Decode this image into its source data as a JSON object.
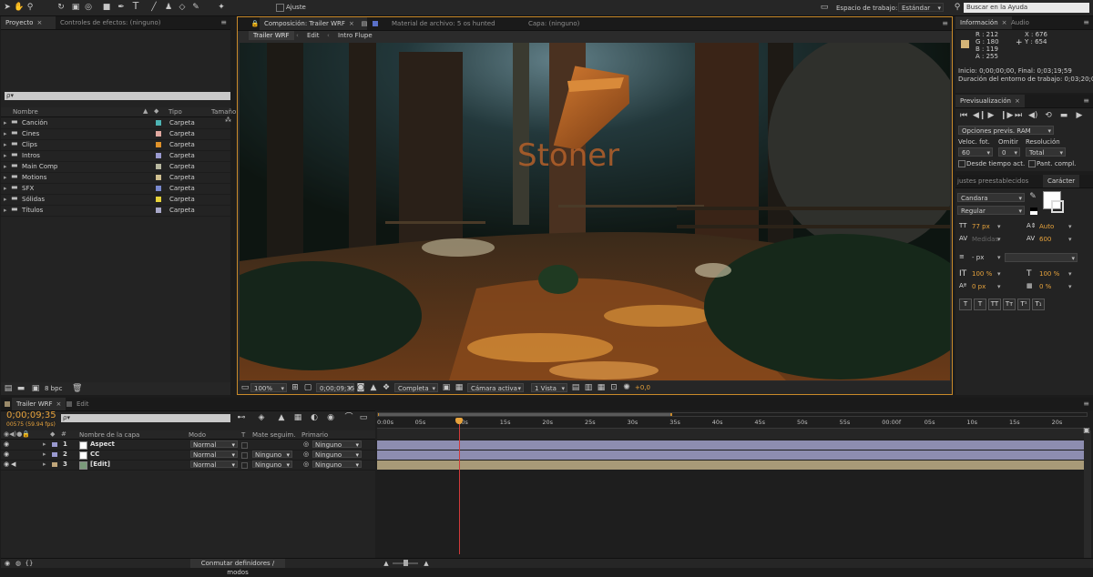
{
  "toolbar": {
    "snap_label": "Ajuste",
    "workspace_label": "Espacio de trabajo:",
    "workspace_value": "Estándar",
    "help_placeholder": "Buscar en la Ayuda"
  },
  "project_panel": {
    "tabs": [
      {
        "label": "Proyecto"
      },
      {
        "label": "Controles de efectos: (ninguno)"
      }
    ],
    "search_placeholder": "ρ▾",
    "columns": {
      "name": "Nombre",
      "type": "Tipo",
      "size": "Tamaño"
    },
    "items": [
      {
        "name": "Canción",
        "type": "Carpeta",
        "color": "#4db3b3"
      },
      {
        "name": "Cines",
        "type": "Carpeta",
        "color": "#e0a8a0"
      },
      {
        "name": "Clips",
        "type": "Carpeta",
        "color": "#e0922a"
      },
      {
        "name": "Intros",
        "type": "Carpeta",
        "color": "#9a9ad0"
      },
      {
        "name": "Main Comp",
        "type": "Carpeta",
        "color": "#b8b8a0"
      },
      {
        "name": "Motions",
        "type": "Carpeta",
        "color": "#d0c090"
      },
      {
        "name": "SFX",
        "type": "Carpeta",
        "color": "#7a8ad0"
      },
      {
        "name": "Sólidas",
        "type": "Carpeta",
        "color": "#e6d23a"
      },
      {
        "name": "Títulos",
        "type": "Carpeta",
        "color": "#a8a8c8"
      }
    ],
    "bpc_label": "8 bpc"
  },
  "composition_panel": {
    "tabs": [
      {
        "label": "Composición: Trailer WRF"
      },
      {
        "label": "Material de archivo: 5 os hunted"
      },
      {
        "label": "Capa: (ninguno)"
      }
    ],
    "breadcrumb": [
      {
        "label": "Trailer WRF"
      },
      {
        "label": "Edit"
      },
      {
        "label": "Intro Flupe"
      }
    ],
    "zoom": "100%",
    "timecode": "0;00;09;35",
    "resolution": "Completa",
    "camera": "Cámara activa",
    "views": "1 Vista",
    "exposure": "+0,0",
    "scene_logo_text": "Stoner"
  },
  "info_panel": {
    "tabs": [
      {
        "label": "Información"
      },
      {
        "label": "Audio"
      }
    ],
    "color_swatch": "#d4b477",
    "r": "R : 212",
    "g": "G : 180",
    "b": "B : 119",
    "a": "A : 255",
    "x": "X : 676",
    "y": "Y : 654",
    "line1": "Inicio: 0;00;00;00, Final: 0;03;19;59",
    "line2": "Duración del entorno de trabajo: 0;03;20;00"
  },
  "preview_panel": {
    "title": "Previsualización",
    "ram_options": "Opciones previs. RAM",
    "fps_label": "Veloc. fot.",
    "skip_label": "Omitir",
    "resolution_label": "Resolución",
    "fps_value": "60",
    "skip_value": "0",
    "resolution_value": "Total",
    "from_current": "Desde tiempo act.",
    "fullscreen": "Pant. compl."
  },
  "character_panel": {
    "tabs": [
      {
        "label": "justes preestablecidos"
      },
      {
        "label": "Carácter"
      }
    ],
    "font": "Candara",
    "style": "Regular",
    "size": "77 px",
    "leading": "Auto",
    "kerning": "Medidas",
    "tracking": "600",
    "stroke": "- px",
    "vscale": "100 %",
    "hscale": "100 %",
    "baseline": "0 px",
    "tsume": "0 %",
    "style_buttons": [
      "T",
      "T",
      "TT",
      "Tᴛ",
      "T¹",
      "T₁"
    ]
  },
  "timeline": {
    "tabs": [
      {
        "label": "Trailer WRF"
      },
      {
        "label": "Edit"
      }
    ],
    "timecode": "0;00;09;35",
    "fps_info": "00575 (59.94 fps)",
    "search_placeholder": "ρ▾",
    "columns": {
      "layer_name": "Nombre de la capa",
      "mode": "Modo",
      "t": "T",
      "track_matte": "Mate seguim.",
      "parent": "Primario"
    },
    "layers": [
      {
        "index": "1",
        "name": "Aspect",
        "mode": "Normal",
        "matte": "",
        "parent": "Ninguno",
        "label_color": "#9a9ad0",
        "swatch": "#ffffff"
      },
      {
        "index": "2",
        "name": "CC",
        "mode": "Normal",
        "matte": "Ninguno",
        "parent": "Ninguno",
        "label_color": "#9a9ad0",
        "swatch": "#ffffff"
      },
      {
        "index": "3",
        "name": "[Edit]",
        "mode": "Normal",
        "matte": "Ninguno",
        "parent": "Ninguno",
        "label_color": "#c0a67a",
        "swatch": "#7a9a7a"
      }
    ],
    "ruler_ticks": [
      "0:00s",
      "05s",
      "10s",
      "15s",
      "20s",
      "25s",
      "30s",
      "35s",
      "40s",
      "45s",
      "50s",
      "55s",
      "00:00f",
      "05s",
      "10s",
      "15s",
      "20s"
    ],
    "footer_label": "Conmutar definidores / modos",
    "bar_colors": {
      "video": "#8d8db0",
      "precomp": "#a89a78"
    },
    "playhead_color": "#d23a3a"
  }
}
